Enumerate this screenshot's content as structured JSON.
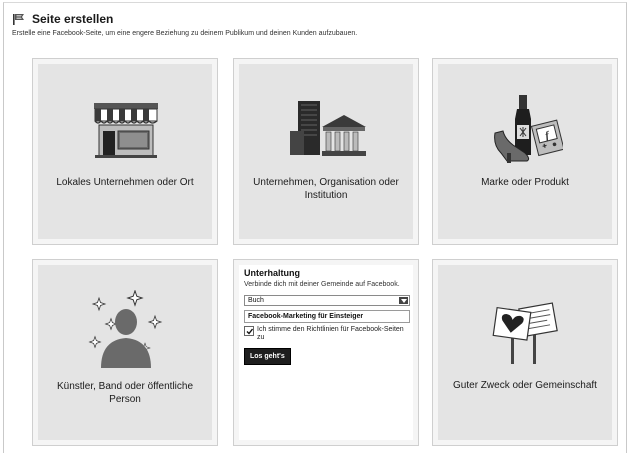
{
  "page": {
    "title": "Seite erstellen",
    "subtitle": "Erstelle eine Facebook-Seite, um eine engere Beziehung zu deinem Publikum und deinen Kunden aufzubauen."
  },
  "categories": [
    {
      "label": "Lokales Unternehmen oder Ort",
      "icon": "storefront-icon"
    },
    {
      "label": "Unternehmen, Organisation oder Institution",
      "icon": "buildings-icon"
    },
    {
      "label": "Marke oder Produkt",
      "icon": "products-icon"
    },
    {
      "label": "Künstler, Band oder öffentliche Person",
      "icon": "star-person-icon"
    },
    {
      "label": "Unterhaltung",
      "icon": ""
    },
    {
      "label": "Guter Zweck oder Gemeinschaft",
      "icon": "signs-icon"
    }
  ],
  "form": {
    "heading": "Unterhaltung",
    "description": "Verbinde dich mit deiner Gemeinde auf Facebook.",
    "category_selected": "Buch",
    "name_value": "Facebook-Marketing für Einsteiger",
    "terms_label": "Ich stimme den Richtlinien für Facebook-Seiten zu",
    "terms_checked": true,
    "submit_label": "Los geht's"
  }
}
